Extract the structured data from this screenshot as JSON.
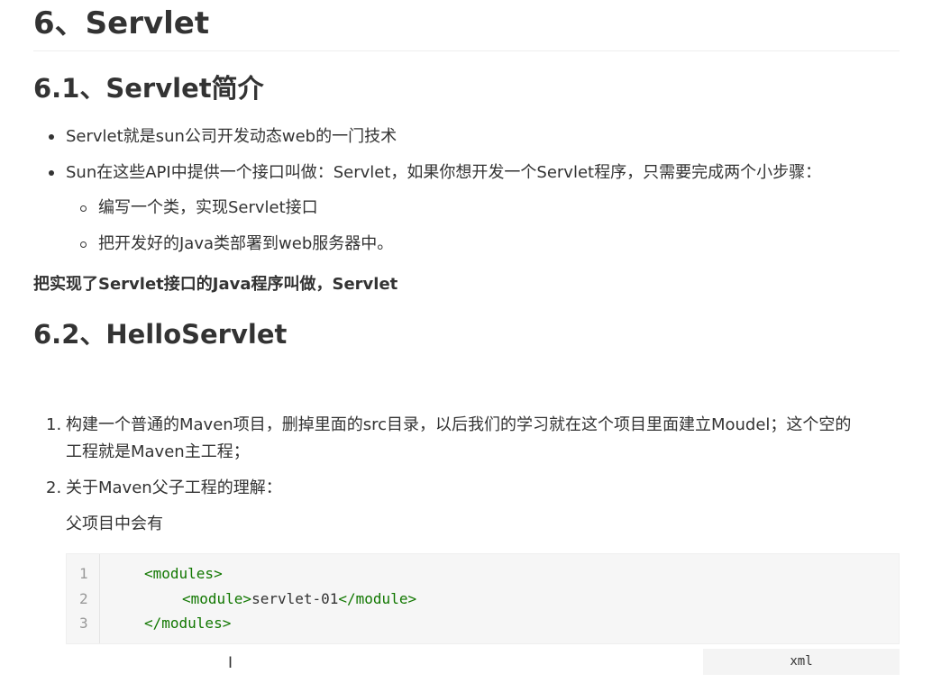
{
  "headings": {
    "h1": "6、Servlet",
    "h2_intro": "6.1、Servlet简介",
    "h2_hello": "6.2、HelloServlet"
  },
  "intro": {
    "bullets": [
      "Servlet就是sun公司开发动态web的一门技术",
      "Sun在这些API中提供一个接口叫做：Servlet，如果你想开发一个Servlet程序，只需要完成两个小步骤："
    ],
    "sub_bullets": [
      "编写一个类，实现Servlet接口",
      "把开发好的Java类部署到web服务器中。"
    ],
    "bold_note": "把实现了Servlet接口的Java程序叫做，Servlet"
  },
  "hello": {
    "steps": [
      {
        "number": "1.",
        "line1": "构建一个普通的Maven项目，删掉里面的src目录，以后我们的学习就在这个项目里面建立Moudel；这个空的",
        "line2": "工程就是Maven主工程；"
      },
      {
        "number": "2.",
        "line1": "关于Maven父子工程的理解："
      }
    ],
    "parent_note": "父项目中会有"
  },
  "code_block": {
    "language": "xml",
    "line_numbers": [
      "1",
      "2",
      "3"
    ],
    "lines": [
      {
        "open": "<modules>"
      },
      {
        "open": "<module>",
        "text": "servlet-01",
        "close": "</module>"
      },
      {
        "close": "</modules>"
      }
    ]
  },
  "cursor_glyph": "I",
  "colors": {
    "text": "#333333",
    "code_tag": "#117700",
    "code_bg": "#f6f6f6"
  }
}
